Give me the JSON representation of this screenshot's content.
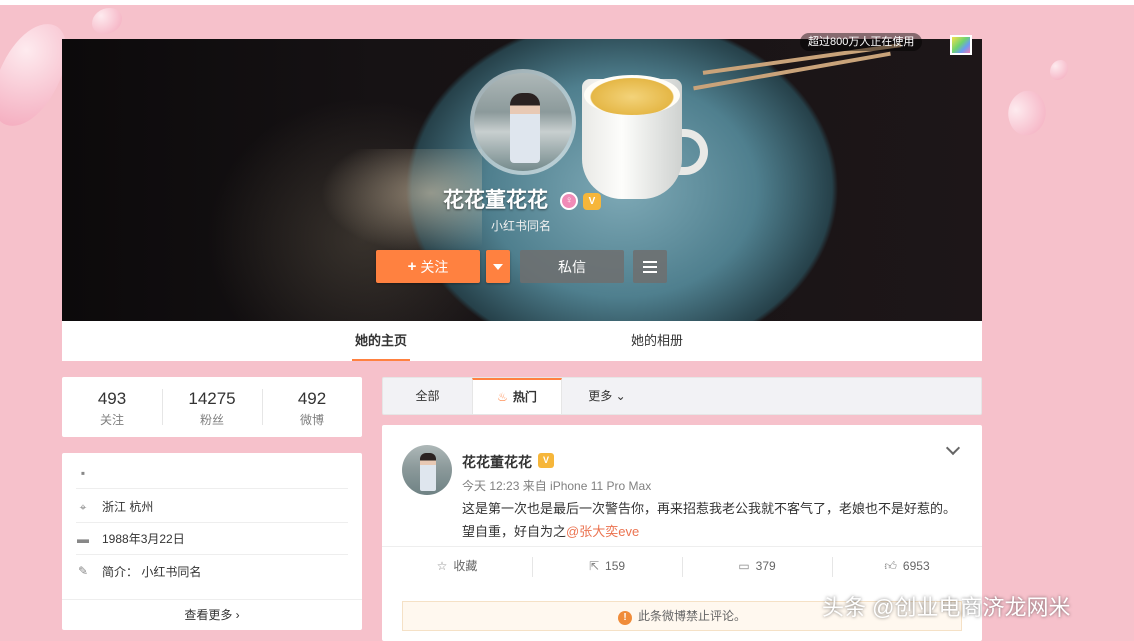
{
  "banner": {
    "usage_text": "超过800万人正在使用"
  },
  "profile": {
    "name": "花花董花花",
    "subname": "小红书同名",
    "follow_label": "关注",
    "message_label": "私信"
  },
  "tabs": [
    "她的主页",
    "她的相册"
  ],
  "stats": [
    {
      "num": "493",
      "label": "关注"
    },
    {
      "num": "14275",
      "label": "粉丝"
    },
    {
      "num": "492",
      "label": "微博"
    }
  ],
  "info": {
    "location": "浙江 杭州",
    "birthday": "1988年3月22日",
    "bio": "简介：  小红书同名",
    "more": "查看更多 ›"
  },
  "feed_filter": [
    "全部",
    "热门",
    "更多 ⌄"
  ],
  "post": {
    "author": "花花董花花",
    "meta": "今天 12:23 来自 iPhone 11 Pro Max",
    "text_1": "这是第一次也是最后一次警告你，再来招惹我老公我就不客气了，老娘也不是好惹的。望自重，好自为之",
    "mention": "@张大奕eve",
    "actions": [
      {
        "icon": "star-icon",
        "label": "收藏"
      },
      {
        "icon": "repost-icon",
        "label": "159"
      },
      {
        "icon": "comment-icon",
        "label": "379"
      },
      {
        "icon": "like-icon",
        "label": "6953"
      }
    ],
    "notice": "此条微博禁止评论。"
  },
  "watermark": "头条 @创业电商济龙网米",
  "colors": {
    "accent": "#ff8140",
    "background": "#f6c1cb",
    "mention": "#eb7350"
  }
}
